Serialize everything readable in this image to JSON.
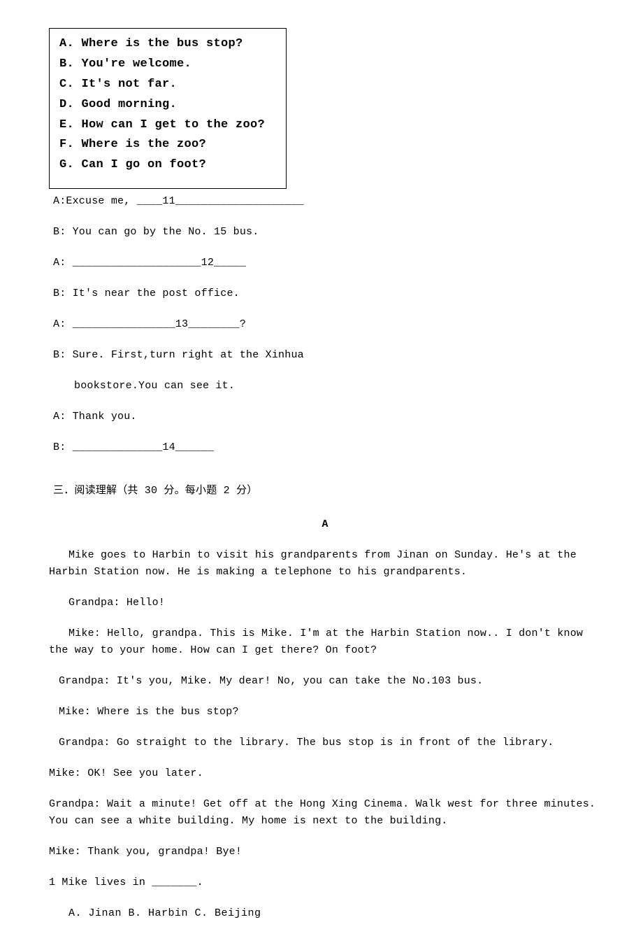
{
  "options_box": {
    "items": [
      "A. Where is the bus stop?",
      "B. You're welcome.",
      "C. It's not far.",
      "D. Good morning.",
      "E. How can I get to the zoo?",
      "F. Where is the zoo?",
      "G. Can I go on foot?"
    ]
  },
  "dialog": {
    "l1": "A:Excuse me, ____11____________________",
    "l2": "B: You can go by the No. 15 bus.",
    "l3": "A: ____________________12_____",
    "l4": "B: It's near the post office.",
    "l5": "A: ________________13________?",
    "l6": "B: Sure. First,turn right at the Xinhua",
    "l6b": "bookstore.You can see it.",
    "l7": "A: Thank you.",
    "l8": "B: ______________14______"
  },
  "section3": {
    "title": "三．阅读理解（共 30 分。每小题 2 分）",
    "label_a": "A",
    "para1": "Mike goes to Harbin to visit his grandparents from Jinan on Sunday. He's at the Harbin Station now. He is making a telephone to his grandparents.",
    "p_grandpa1": "Grandpa: Hello!",
    "p_mike1": "Mike: Hello, grandpa. This is Mike. I'm at the Harbin Station now.. I don't know the way to your home. How can I get there? On foot?",
    "p_grandpa2": "Grandpa: It's you, Mike. My dear! No, you can take the No.103 bus.",
    "p_mike2": "Mike: Where is the bus stop?",
    "p_grandpa3": "Grandpa: Go straight to the library. The bus stop is in front of the library.",
    "p_mike3": "Mike: OK! See you later.",
    "p_grandpa4": "Grandpa: Wait a minute! Get off at the Hong Xing Cinema. Walk west for three minutes. You can see a white building. My home is next to the building.",
    "p_mike4": "Mike: Thank you, grandpa! Bye!",
    "q1": "1 Mike lives in _______.",
    "q1_choices": "A. Jinan    B. Harbin    C. Beijing"
  }
}
